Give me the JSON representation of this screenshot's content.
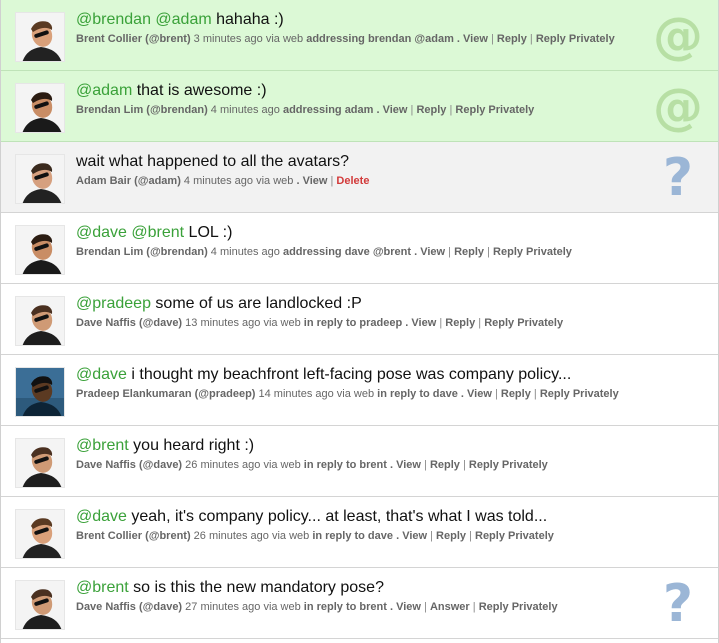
{
  "colors": {
    "mention_bg": "#dcf9d6",
    "question_bg": "#f2f2f2",
    "mention_text": "#3aa139",
    "delete_text": "#d23a3a",
    "at_badge": "#b7dfa4",
    "question_badge": "#9bb6d6"
  },
  "tweets": [
    {
      "mentions": "@brendan @adam",
      "text": " hahaha :)",
      "author": "Brent Collier (@brent)",
      "time": " 3 minutes ago via web ",
      "address": "addressing brendan @adam",
      "actions": [
        ". View",
        "Reply",
        "Reply Privately"
      ],
      "badge": "@",
      "avatar": "brent"
    },
    {
      "mentions": "@adam",
      "text": " that is awesome :)",
      "author": "Brendan Lim (@brendan)",
      "time": " 4 minutes ago ",
      "address": "addressing adam",
      "actions": [
        ". View",
        "Reply",
        "Reply Privately"
      ],
      "badge": "@",
      "avatar": "brendan"
    },
    {
      "mentions": "",
      "text": "wait what happened to all the avatars?",
      "author": "Adam Bair (@adam)",
      "time": " 4 minutes ago via web ",
      "address": "",
      "actions": [
        ". View",
        "Delete"
      ],
      "badge": "?",
      "avatar": "adam"
    },
    {
      "mentions": "@dave @brent",
      "text": " LOL :)",
      "author": "Brendan Lim (@brendan)",
      "time": " 4 minutes ago ",
      "address": "addressing dave @brent",
      "actions": [
        ". View",
        "Reply",
        "Reply Privately"
      ],
      "badge": "",
      "avatar": "brendan"
    },
    {
      "mentions": "@pradeep",
      "text": " some of us are landlocked :P",
      "author": "Dave Naffis (@dave)",
      "time": " 13 minutes ago via web ",
      "address": "in reply to pradeep",
      "actions": [
        ". View",
        "Reply",
        "Reply Privately"
      ],
      "badge": "",
      "avatar": "dave"
    },
    {
      "mentions": "@dave",
      "text": " i thought my beachfront left-facing pose was company policy...",
      "author": "Pradeep Elankumaran (@pradeep)",
      "time": " 14 minutes ago via web ",
      "address": "in reply to dave",
      "actions": [
        ". View",
        "Reply",
        "Reply Privately"
      ],
      "badge": "",
      "avatar": "pradeep"
    },
    {
      "mentions": "@brent",
      "text": " you heard right :)",
      "author": "Dave Naffis (@dave)",
      "time": " 26 minutes ago via web ",
      "address": "in reply to brent",
      "actions": [
        ". View",
        "Reply",
        "Reply Privately"
      ],
      "badge": "",
      "avatar": "dave"
    },
    {
      "mentions": "@dave",
      "text": " yeah, it's company policy... at least, that's what I was told...",
      "author": "Brent Collier (@brent)",
      "time": " 26 minutes ago via web ",
      "address": "in reply to dave",
      "actions": [
        ". View",
        "Reply",
        "Reply Privately"
      ],
      "badge": "",
      "avatar": "brent"
    },
    {
      "mentions": "@brent",
      "text": " so is this the new mandatory pose?",
      "author": "Dave Naffis (@dave)",
      "time": " 27 minutes ago via web ",
      "address": "in reply to brent",
      "actions": [
        ". View",
        "Answer",
        "Reply Privately"
      ],
      "badge": "?",
      "avatar": "dave"
    }
  ]
}
